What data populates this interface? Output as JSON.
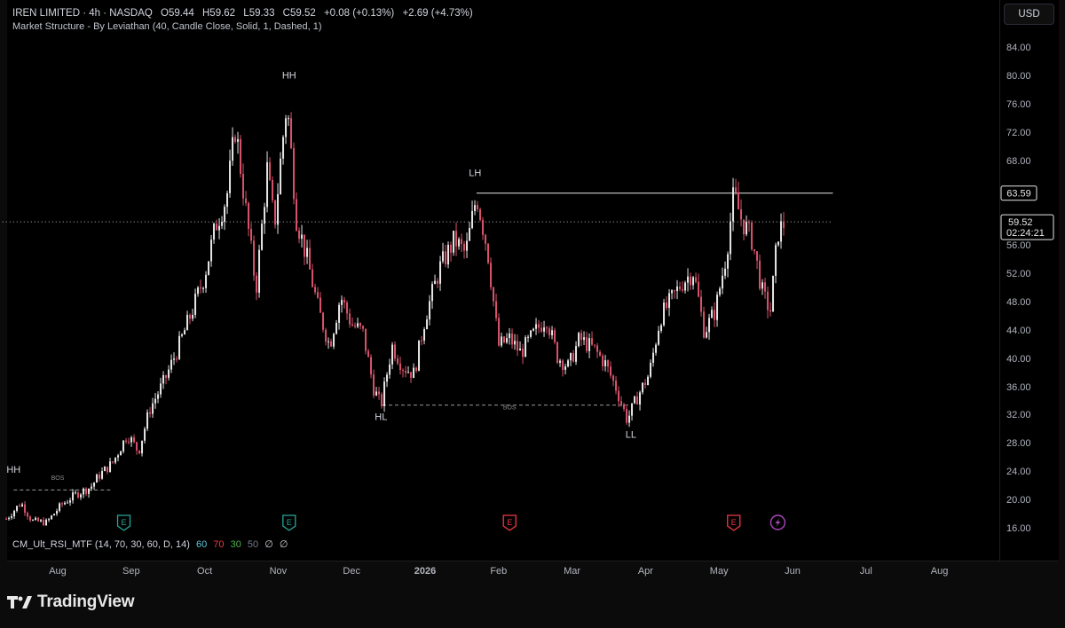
{
  "header": {
    "symbol": "IREN LIMITED · 4h · NASDAQ",
    "open_label": "O",
    "open": "59.44",
    "high_label": "H",
    "high": "59.62",
    "low_label": "L",
    "low": "59.33",
    "close_label": "C",
    "close": "59.52",
    "change": "+0.08 (+0.13%)",
    "change2": "+2.69 (+4.73%)",
    "indicator": "Market Structure - By Leviathan (40, Candle Close, Solid, 1, Dashed, 1)"
  },
  "currency_button": "USD",
  "rsi": {
    "name": "CM_Ult_RSI_MTF (14, 70, 30, 60, D, 14)",
    "v1": "60",
    "v2": "70",
    "v3": "30",
    "v4": "50",
    "v5": "∅",
    "v6": "∅"
  },
  "colors": {
    "up": "#e6e6e6",
    "down": "#d9536b",
    "background": "#000000",
    "level_line": "#e6e6e6",
    "rsi_v1": "#5ec7d8",
    "rsi_v2": "#f23645",
    "rsi_v3": "#4caf50",
    "rsi_v4": "#787b86",
    "earnings_past": "#26a69a",
    "earnings_future": "#f23645",
    "dividend": "#ab47bc"
  },
  "price_labels": {
    "level": "63.59",
    "last": "59.52",
    "countdown": "02:24:21"
  },
  "brand": "TradingView",
  "chart_data": {
    "type": "candlestick",
    "title": "IREN LIMITED · 4h · NASDAQ",
    "ylim": [
      16,
      86
    ],
    "y_ticks": [
      "84.00",
      "80.00",
      "76.00",
      "72.00",
      "68.00",
      "56.00",
      "52.00",
      "48.00",
      "44.00",
      "40.00",
      "36.00",
      "32.00",
      "28.00",
      "24.00",
      "20.00",
      "16.00"
    ],
    "x_ticks": [
      "Aug",
      "Sep",
      "Oct",
      "Nov",
      "Dec",
      "2026",
      "Feb",
      "Mar",
      "Apr",
      "May",
      "Jun",
      "Jul",
      "Aug"
    ],
    "x_tick_months": [
      0,
      1,
      2,
      3,
      4,
      5,
      6,
      7,
      8,
      9,
      10,
      11,
      12
    ],
    "month_origin": "Aug",
    "price_series_approx": [
      [
        -0.7,
        17.5
      ],
      [
        -0.5,
        19.8
      ],
      [
        -0.35,
        17.2
      ],
      [
        -0.15,
        17.0
      ],
      [
        0.05,
        19.5
      ],
      [
        0.25,
        21.0
      ],
      [
        0.45,
        22.0
      ],
      [
        0.55,
        23.5
      ],
      [
        0.75,
        25.5
      ],
      [
        0.95,
        29.5
      ],
      [
        1.1,
        27.0
      ],
      [
        1.25,
        33.0
      ],
      [
        1.45,
        37.0
      ],
      [
        1.65,
        42.0
      ],
      [
        1.85,
        47.5
      ],
      [
        2.0,
        52.0
      ],
      [
        2.15,
        59.0
      ],
      [
        2.3,
        63.0
      ],
      [
        2.42,
        73.0
      ],
      [
        2.55,
        62.0
      ],
      [
        2.7,
        50.0
      ],
      [
        2.85,
        67.0
      ],
      [
        2.95,
        59.0
      ],
      [
        3.05,
        70.0
      ],
      [
        3.12,
        76.5
      ],
      [
        3.25,
        60.0
      ],
      [
        3.4,
        54.0
      ],
      [
        3.55,
        47.0
      ],
      [
        3.7,
        42.0
      ],
      [
        3.85,
        49.0
      ],
      [
        4.0,
        45.0
      ],
      [
        4.15,
        44.0
      ],
      [
        4.3,
        36.0
      ],
      [
        4.4,
        33.5
      ],
      [
        4.55,
        42.0
      ],
      [
        4.7,
        39.0
      ],
      [
        4.85,
        38.0
      ],
      [
        5.0,
        46.0
      ],
      [
        5.2,
        53.0
      ],
      [
        5.4,
        57.0
      ],
      [
        5.55,
        55.0
      ],
      [
        5.7,
        63.3
      ],
      [
        5.85,
        55.5
      ],
      [
        6.0,
        42.0
      ],
      [
        6.15,
        43.0
      ],
      [
        6.3,
        41.0
      ],
      [
        6.5,
        44.0
      ],
      [
        6.65,
        46.0
      ],
      [
        6.8,
        40.5
      ],
      [
        6.95,
        39.0
      ],
      [
        7.1,
        43.0
      ],
      [
        7.3,
        41.5
      ],
      [
        7.45,
        39.5
      ],
      [
        7.6,
        36.0
      ],
      [
        7.75,
        31.5
      ],
      [
        7.9,
        35.0
      ],
      [
        8.05,
        38.0
      ],
      [
        8.2,
        46.0
      ],
      [
        8.35,
        48.5
      ],
      [
        8.5,
        51.0
      ],
      [
        8.65,
        52.5
      ],
      [
        8.8,
        44.0
      ],
      [
        8.95,
        47.0
      ],
      [
        9.1,
        55.0
      ],
      [
        9.2,
        63.5
      ],
      [
        9.3,
        60.0
      ],
      [
        9.45,
        57.0
      ],
      [
        9.6,
        49.0
      ],
      [
        9.7,
        47.0
      ],
      [
        9.8,
        58.0
      ],
      [
        9.9,
        59.52
      ]
    ],
    "annotations": [
      {
        "text": "HH",
        "x": -0.6,
        "y": 24.0
      },
      {
        "text": "HH",
        "x": 3.15,
        "y": 79.8
      },
      {
        "text": "LH",
        "x": 5.68,
        "y": 66.0
      },
      {
        "text": "HL",
        "x": 4.4,
        "y": 31.5
      },
      {
        "text": "LL",
        "x": 7.8,
        "y": 29.0
      },
      {
        "text": "BOS",
        "x": 0.0,
        "y": 23.0
      },
      {
        "text": "BOS",
        "x": 6.15,
        "y": 33.0
      }
    ],
    "levels": [
      {
        "type": "solid",
        "y": 63.59,
        "x_from": 5.7,
        "x_to": 10.55
      },
      {
        "type": "dashed",
        "y": 33.6,
        "x_from": 4.42,
        "x_to": 7.8
      },
      {
        "type": "dashed",
        "y": 21.6,
        "x_from": -0.6,
        "x_to": 0.75
      },
      {
        "type": "dotted",
        "y": 59.52,
        "x_from": -0.8,
        "x_to": 10.55
      }
    ],
    "events": [
      {
        "kind": "E",
        "x": 0.9,
        "state": "past"
      },
      {
        "kind": "E",
        "x": 3.15,
        "state": "past"
      },
      {
        "kind": "E",
        "x": 6.15,
        "state": "future"
      },
      {
        "kind": "E",
        "x": 9.2,
        "state": "future"
      },
      {
        "kind": "dividend",
        "x": 9.8,
        "state": "future"
      }
    ]
  }
}
